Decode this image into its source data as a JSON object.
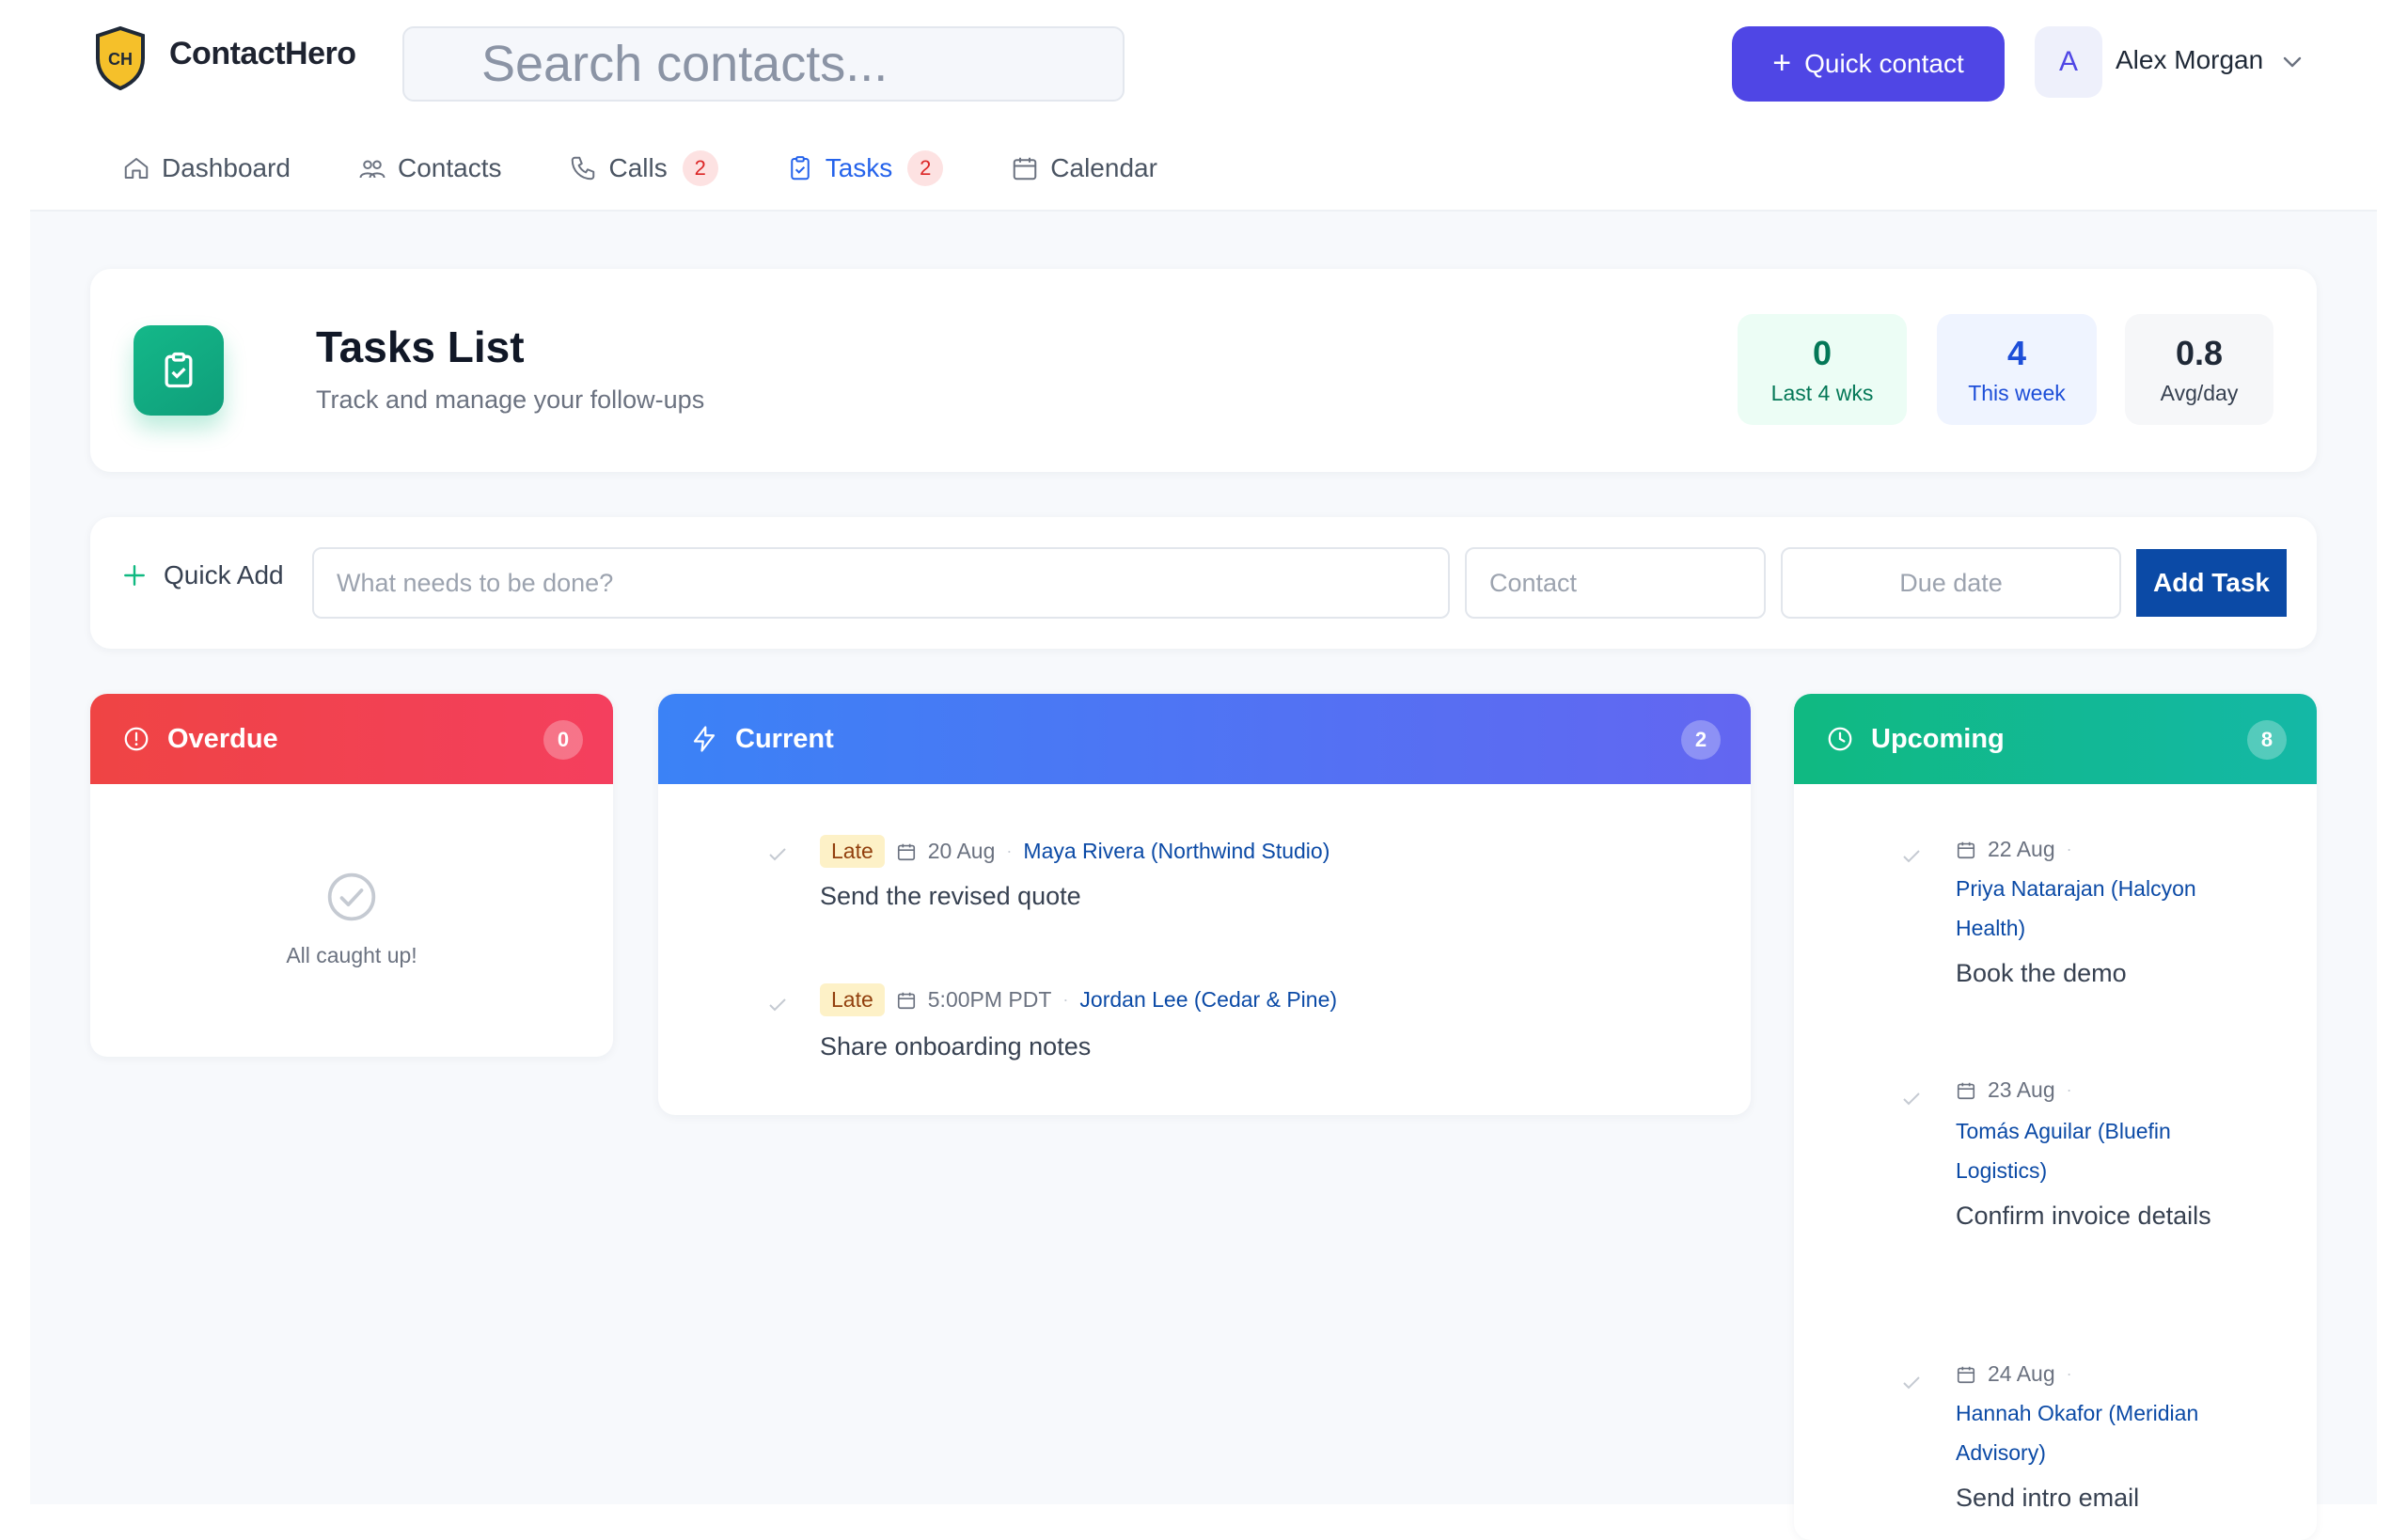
{
  "app": {
    "brand": "ContactHero",
    "logo_text": "CH",
    "search_placeholder": "Search contacts...",
    "quick_contact_label": "Quick contact",
    "user": {
      "initial": "A",
      "name": "Alex Morgan"
    }
  },
  "nav": [
    {
      "label": "Dashboard",
      "icon": "home-icon",
      "badge": null,
      "active": false
    },
    {
      "label": "Contacts",
      "icon": "people-icon",
      "badge": null,
      "active": false
    },
    {
      "label": "Calls",
      "icon": "phone-icon",
      "badge": "2",
      "active": false
    },
    {
      "label": "Tasks",
      "icon": "clipboard-check-icon",
      "badge": "2",
      "active": true
    },
    {
      "label": "Calendar",
      "icon": "calendar-icon",
      "badge": null,
      "active": false
    }
  ],
  "page": {
    "title": "Tasks List",
    "subtitle": "Track and manage your follow-ups",
    "stats": [
      {
        "value": "0",
        "label": "Last 4 wks"
      },
      {
        "value": "4",
        "label": "This week"
      },
      {
        "value": "0.8",
        "label": "Avg/day"
      }
    ]
  },
  "quick_add": {
    "label": "Quick Add",
    "task_placeholder": "What needs to be done?",
    "contact_placeholder": "Contact",
    "date_placeholder": "Due date",
    "button_label": "Add Task"
  },
  "columns": {
    "overdue": {
      "title": "Overdue",
      "count": "0",
      "empty_text": "All caught up!"
    },
    "current": {
      "title": "Current",
      "count": "2",
      "tasks": [
        {
          "tag": "Late",
          "date": "20 Aug",
          "contact": "Maya Rivera (Northwind Studio)",
          "title": "Send the revised quote"
        },
        {
          "tag": "Late",
          "date": "5:00PM PDT",
          "contact": "Jordan Lee (Cedar & Pine)",
          "title": "Share onboarding notes"
        }
      ]
    },
    "upcoming": {
      "title": "Upcoming",
      "count": "8",
      "tasks": [
        {
          "date": "22 Aug",
          "contact": "Priya Natarajan (Halcyon Health)",
          "title": "Book the demo"
        },
        {
          "date": "23 Aug",
          "contact": "Tomás Aguilar (Bluefin Logistics)",
          "title": "Confirm invoice details"
        },
        {
          "date": "24 Aug",
          "contact": "Hannah Okafor (Meridian Advisory)",
          "title": "Send intro email"
        }
      ]
    }
  },
  "colors": {
    "brand_primary": "#4f46e5",
    "accent_blue": "#0b4aa6",
    "overdue": "#ef4444",
    "current": "#3b82f6",
    "upcoming": "#10b981"
  }
}
